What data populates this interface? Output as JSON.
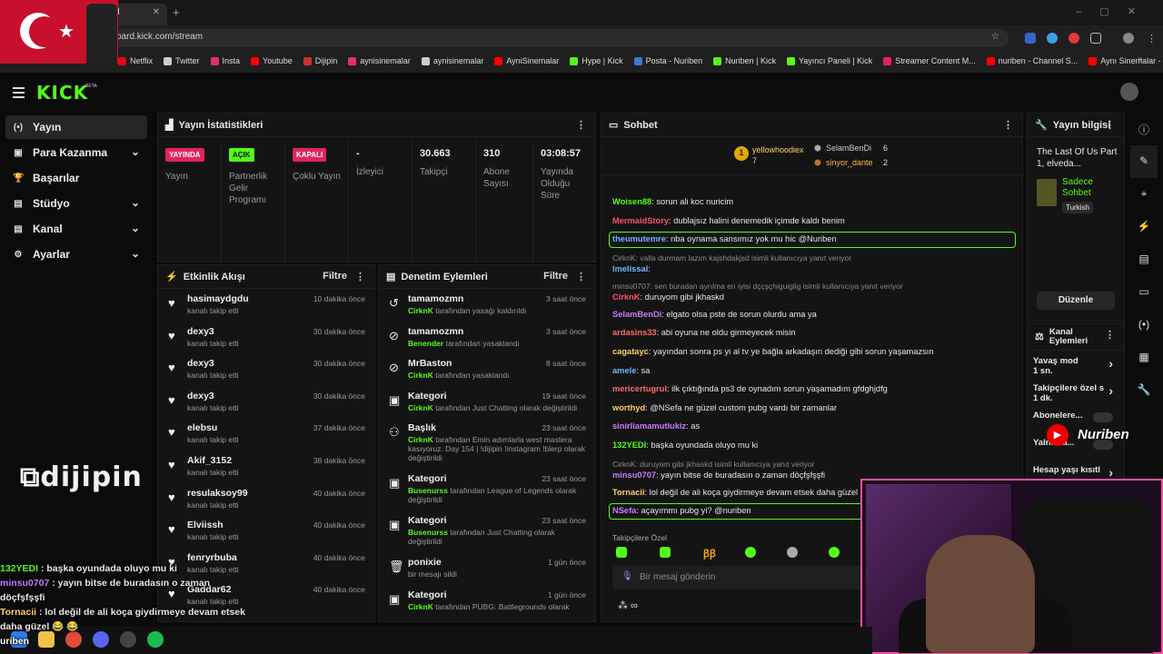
{
  "browser": {
    "tab_title": "d",
    "url": "oard.kick.com/stream",
    "bookmarks": [
      {
        "label": "Netflix",
        "color": "#e50914"
      },
      {
        "label": "Twitter",
        "color": "#cccccc"
      },
      {
        "label": "Insta",
        "color": "#e1306c"
      },
      {
        "label": "Youtube",
        "color": "#ff0000"
      },
      {
        "label": "Dijipin",
        "color": "#cc3333"
      },
      {
        "label": "aynisinemalar",
        "color": "#e1306c"
      },
      {
        "label": "aynisinemalar",
        "color": "#cccccc"
      },
      {
        "label": "AyniSinemalar",
        "color": "#ff0000"
      },
      {
        "label": "Hype | Kick",
        "color": "#53fc18"
      },
      {
        "label": "Posta - Nuriben",
        "color": "#3a7bd5"
      },
      {
        "label": "Nuriben | Kick",
        "color": "#53fc18"
      },
      {
        "label": "Yayıncı Paneli | Kick",
        "color": "#53fc18"
      },
      {
        "label": "Streamer Content M...",
        "color": "#e91e63"
      },
      {
        "label": "nuriben - Channel S...",
        "color": "#ff0000"
      },
      {
        "label": "Aynı Sinemalar - Ça...",
        "color": "#ff0000"
      }
    ]
  },
  "header": {
    "logo": "KICK",
    "beta": "BETA"
  },
  "sidebar": {
    "items": [
      {
        "label": "Yayın",
        "icon": "(•)",
        "chevron": ""
      },
      {
        "label": "Para Kazanma",
        "icon": "▣",
        "chevron": "⌄"
      },
      {
        "label": "Başarılar",
        "icon": "🏆",
        "chevron": ""
      },
      {
        "label": "Stüdyo",
        "icon": "▤",
        "chevron": "⌄"
      },
      {
        "label": "Kanal",
        "icon": "▤",
        "chevron": "⌄"
      },
      {
        "label": "Ayarlar",
        "icon": "⚙",
        "chevron": "⌄"
      }
    ]
  },
  "stats": {
    "title": "Yayın İstatistikleri",
    "cols": [
      {
        "badge": "YAYINDA",
        "badge_color": "#e0245e",
        "value": "",
        "label": "Yayın"
      },
      {
        "badge": "AÇIK",
        "badge_color": "#53fc18",
        "value": "",
        "label": "Partnerlik Gelir Programı"
      },
      {
        "badge": "KAPALI",
        "badge_color": "#e0245e",
        "value": "",
        "label": "Çoklu Yayın"
      },
      {
        "badge": "",
        "badge_color": "",
        "value": "-",
        "label": "İzleyici"
      },
      {
        "badge": "",
        "badge_color": "",
        "value": "30.663",
        "label": "Takipçi"
      },
      {
        "badge": "",
        "badge_color": "",
        "value": "310",
        "label": "Abone Sayısı"
      },
      {
        "badge": "",
        "badge_color": "",
        "value": "03:08:57",
        "label": "Yayında Olduğu Süre"
      }
    ]
  },
  "activity": {
    "title": "Etkinlik Akışı",
    "filter": "Filtre",
    "items": [
      {
        "name": "hasimaydgdu",
        "sub": "kanalı takip etti",
        "time": "10 dakika önce"
      },
      {
        "name": "dexy3",
        "sub": "kanalı takip etti",
        "time": "30 dakika önce"
      },
      {
        "name": "dexy3",
        "sub": "kanalı takip etti",
        "time": "30 dakika önce"
      },
      {
        "name": "dexy3",
        "sub": "kanalı takip etti",
        "time": "30 dakika önce"
      },
      {
        "name": "elebsu",
        "sub": "kanalı takip etti",
        "time": "37 dakika önce"
      },
      {
        "name": "Akif_3152",
        "sub": "kanalı takip etti",
        "time": "38 dakika önce"
      },
      {
        "name": "resulaksoy99",
        "sub": "kanalı takip etti",
        "time": "40 dakika önce"
      },
      {
        "name": "Elviissh",
        "sub": "kanalı takip etti",
        "time": "40 dakika önce"
      },
      {
        "name": "fenryrbuba",
        "sub": "kanalı takip etti",
        "time": "40 dakika önce"
      },
      {
        "name": "Gaddar62",
        "sub": "kanalı takip etti",
        "time": "40 dakika önce"
      }
    ]
  },
  "moderation": {
    "title": "Denetim Eylemleri",
    "filter": "Filtre",
    "items": [
      {
        "icon": "↺",
        "title": "tamamozmn",
        "actor": "CirknK",
        "text": " tarafından yasağı kaldırıldı",
        "time": "3 saat önce"
      },
      {
        "icon": "⊘",
        "title": "tamamozmn",
        "actor": "Benender",
        "text": " tarafından yasaklandı",
        "time": "3 saat önce"
      },
      {
        "icon": "⊘",
        "title": "MrBaston",
        "actor": "CirknK",
        "text": " tarafından yasaklandı",
        "time": "8 saat önce"
      },
      {
        "icon": "▣",
        "title": "Kategori",
        "actor": "CirknK",
        "text": " tarafından Just Chatting olarak değiştirildi",
        "time": "19 saat önce"
      },
      {
        "icon": "⚇",
        "title": "Başlık",
        "actor": "CirknK",
        "text": " tarafından Emin adımlarla west mastera kasıyoruz. Day 154 | !dijipin !instagram !blerp olarak değiştirildi",
        "time": "23 saat önce"
      },
      {
        "icon": "▣",
        "title": "Kategori",
        "actor": "Busenurss",
        "text": " tarafından League of Legends olarak değiştirildi",
        "time": "23 saat önce"
      },
      {
        "icon": "▣",
        "title": "Kategori",
        "actor": "Busenurss",
        "text": " tarafından Just Chatting olarak değiştirildi",
        "time": "23 saat önce"
      },
      {
        "icon": "🗑",
        "title": "ponixie",
        "actor": "",
        "text": "bir mesajı sildi",
        "time": "1 gün önce"
      },
      {
        "icon": "▣",
        "title": "Kategori",
        "actor": "CirknK",
        "text": " tarafından PUBG: Battlegrounds olarak",
        "time": "1 gün önce"
      }
    ]
  },
  "chat": {
    "title": "Sohbet",
    "gifters": {
      "first": {
        "name": "yellowhoodiex",
        "count": "7"
      },
      "second": {
        "name": "SelamBenDi",
        "count": "6"
      },
      "third": {
        "name": "sinyor_dante",
        "count": "2"
      }
    },
    "messages": [
      {
        "user": "Woisen88",
        "color": "#53fc18",
        "text": ": sorun ali koc nuricim",
        "reply": ""
      },
      {
        "user": "MermaidStory",
        "color": "#ff4f6e",
        "text": ": dublajsız halini denemedik içimde kaldı benim",
        "reply": ""
      },
      {
        "user": "theumutemre",
        "color": "#6fb4ff",
        "text": ": nba oynama sansımız yok mu hic @Nuriben",
        "reply": ""
      },
      {
        "user": "lmelissal",
        "color": "#6fb4ff",
        "text": ":",
        "reply": "CirknK: valla durmam lazım kajshdakjsd isimli kullanıcıya yanıt veriyor"
      },
      {
        "user": "CirknK",
        "color": "#ff4f6e",
        "text": ": duruyom gibi jkhaskd",
        "reply": "minsu0707: sen buradan ayrılma en iyisi dççşçhiguiglig isimli kullanıcıya yanıt veriyor"
      },
      {
        "user": "SelamBenDi",
        "color": "#c77dff",
        "text": ": elgato olsa pste de sorun olurdu ama ya",
        "reply": ""
      },
      {
        "user": "ardasins33",
        "color": "#ff6b6b",
        "text": ": abi oyuna ne oldu girmeyecek misin",
        "reply": ""
      },
      {
        "user": "cagatayc",
        "color": "#ffd166",
        "text": ": yayından sonra ps yi al tv ye bağla arkadaşın dediği gibi sorun yaşamazsın",
        "reply": ""
      },
      {
        "user": "amele",
        "color": "#6fb4ff",
        "text": ": sa",
        "reply": ""
      },
      {
        "user": "mericertugrul",
        "color": "#ff6b6b",
        "text": ": ilk çıktığında ps3 de oynadım sorun yaşamadım gfdghjdfg",
        "reply": ""
      },
      {
        "user": "worthyd",
        "color": "#ffd166",
        "text": ": @NSefa ne güzel custom pubg vardı bir zamanlar",
        "reply": ""
      },
      {
        "user": "sinirliamamutlukiz",
        "color": "#c77dff",
        "text": ": as",
        "reply": ""
      },
      {
        "user": "132YEDI",
        "color": "#53fc18",
        "text": ": başka oyundada oluyo mu ki",
        "reply": ""
      },
      {
        "user": "minsu0707",
        "color": "#c77dff",
        "text": ": yayın bitse de buradasın o zaman döçfşfşşfi",
        "reply": "CirknK: duruyom gibi jkhaskd isimli kullanıcıya yanıt veriyor"
      },
      {
        "user": "Tornacii",
        "color": "#ffd166",
        "text": ": lol değil de ali koça giydirmeye devam etsek daha güzel",
        "reply": ""
      },
      {
        "user": "NSefa",
        "color": "#c77dff",
        "text": ": açayımmı pubg yi? @nuriben",
        "reply": ""
      }
    ],
    "follower_note": "Takipçilere Özel",
    "input_placeholder": "Bir mesaj gönderin"
  },
  "info": {
    "title": "Yayın bilgisi",
    "stream_title": "The Last Of Us Part 1, elveda...",
    "category": "Sadece Sohbet",
    "language": "Turkish",
    "edit_button": "Düzenle"
  },
  "channel_actions": {
    "title": "Kanal Eylemleri",
    "items": [
      {
        "label": "Yavaş mod",
        "value": "1 sn."
      },
      {
        "label": "Takipçilere özel s",
        "value": "1 dk."
      },
      {
        "label": "Abonelere...",
        "value": ""
      },
      {
        "label": "Yalnızca...",
        "value": ""
      },
      {
        "label": "Hesap yaşı kısıtl",
        "value": ""
      }
    ]
  },
  "overlay": {
    "dijipin": "dijipin",
    "nuriben": "Nuriben",
    "chat": [
      {
        "user": "132YEDI",
        "text": " : başka oyundada oluyo mu ki",
        "color": "#53fc18"
      },
      {
        "user": "minsu0707",
        "text": " : yayın bitse de buradasın o zaman döçfşfşşfi",
        "color": "#c77dff"
      },
      {
        "user": "Tornacii",
        "text": " : lol değil de ali koça giydirmeye devam etsek daha güzel 😂 😂",
        "color": "#ffd166"
      },
      {
        "user": "uriben",
        "text": "",
        "color": "#ffffff"
      }
    ]
  }
}
